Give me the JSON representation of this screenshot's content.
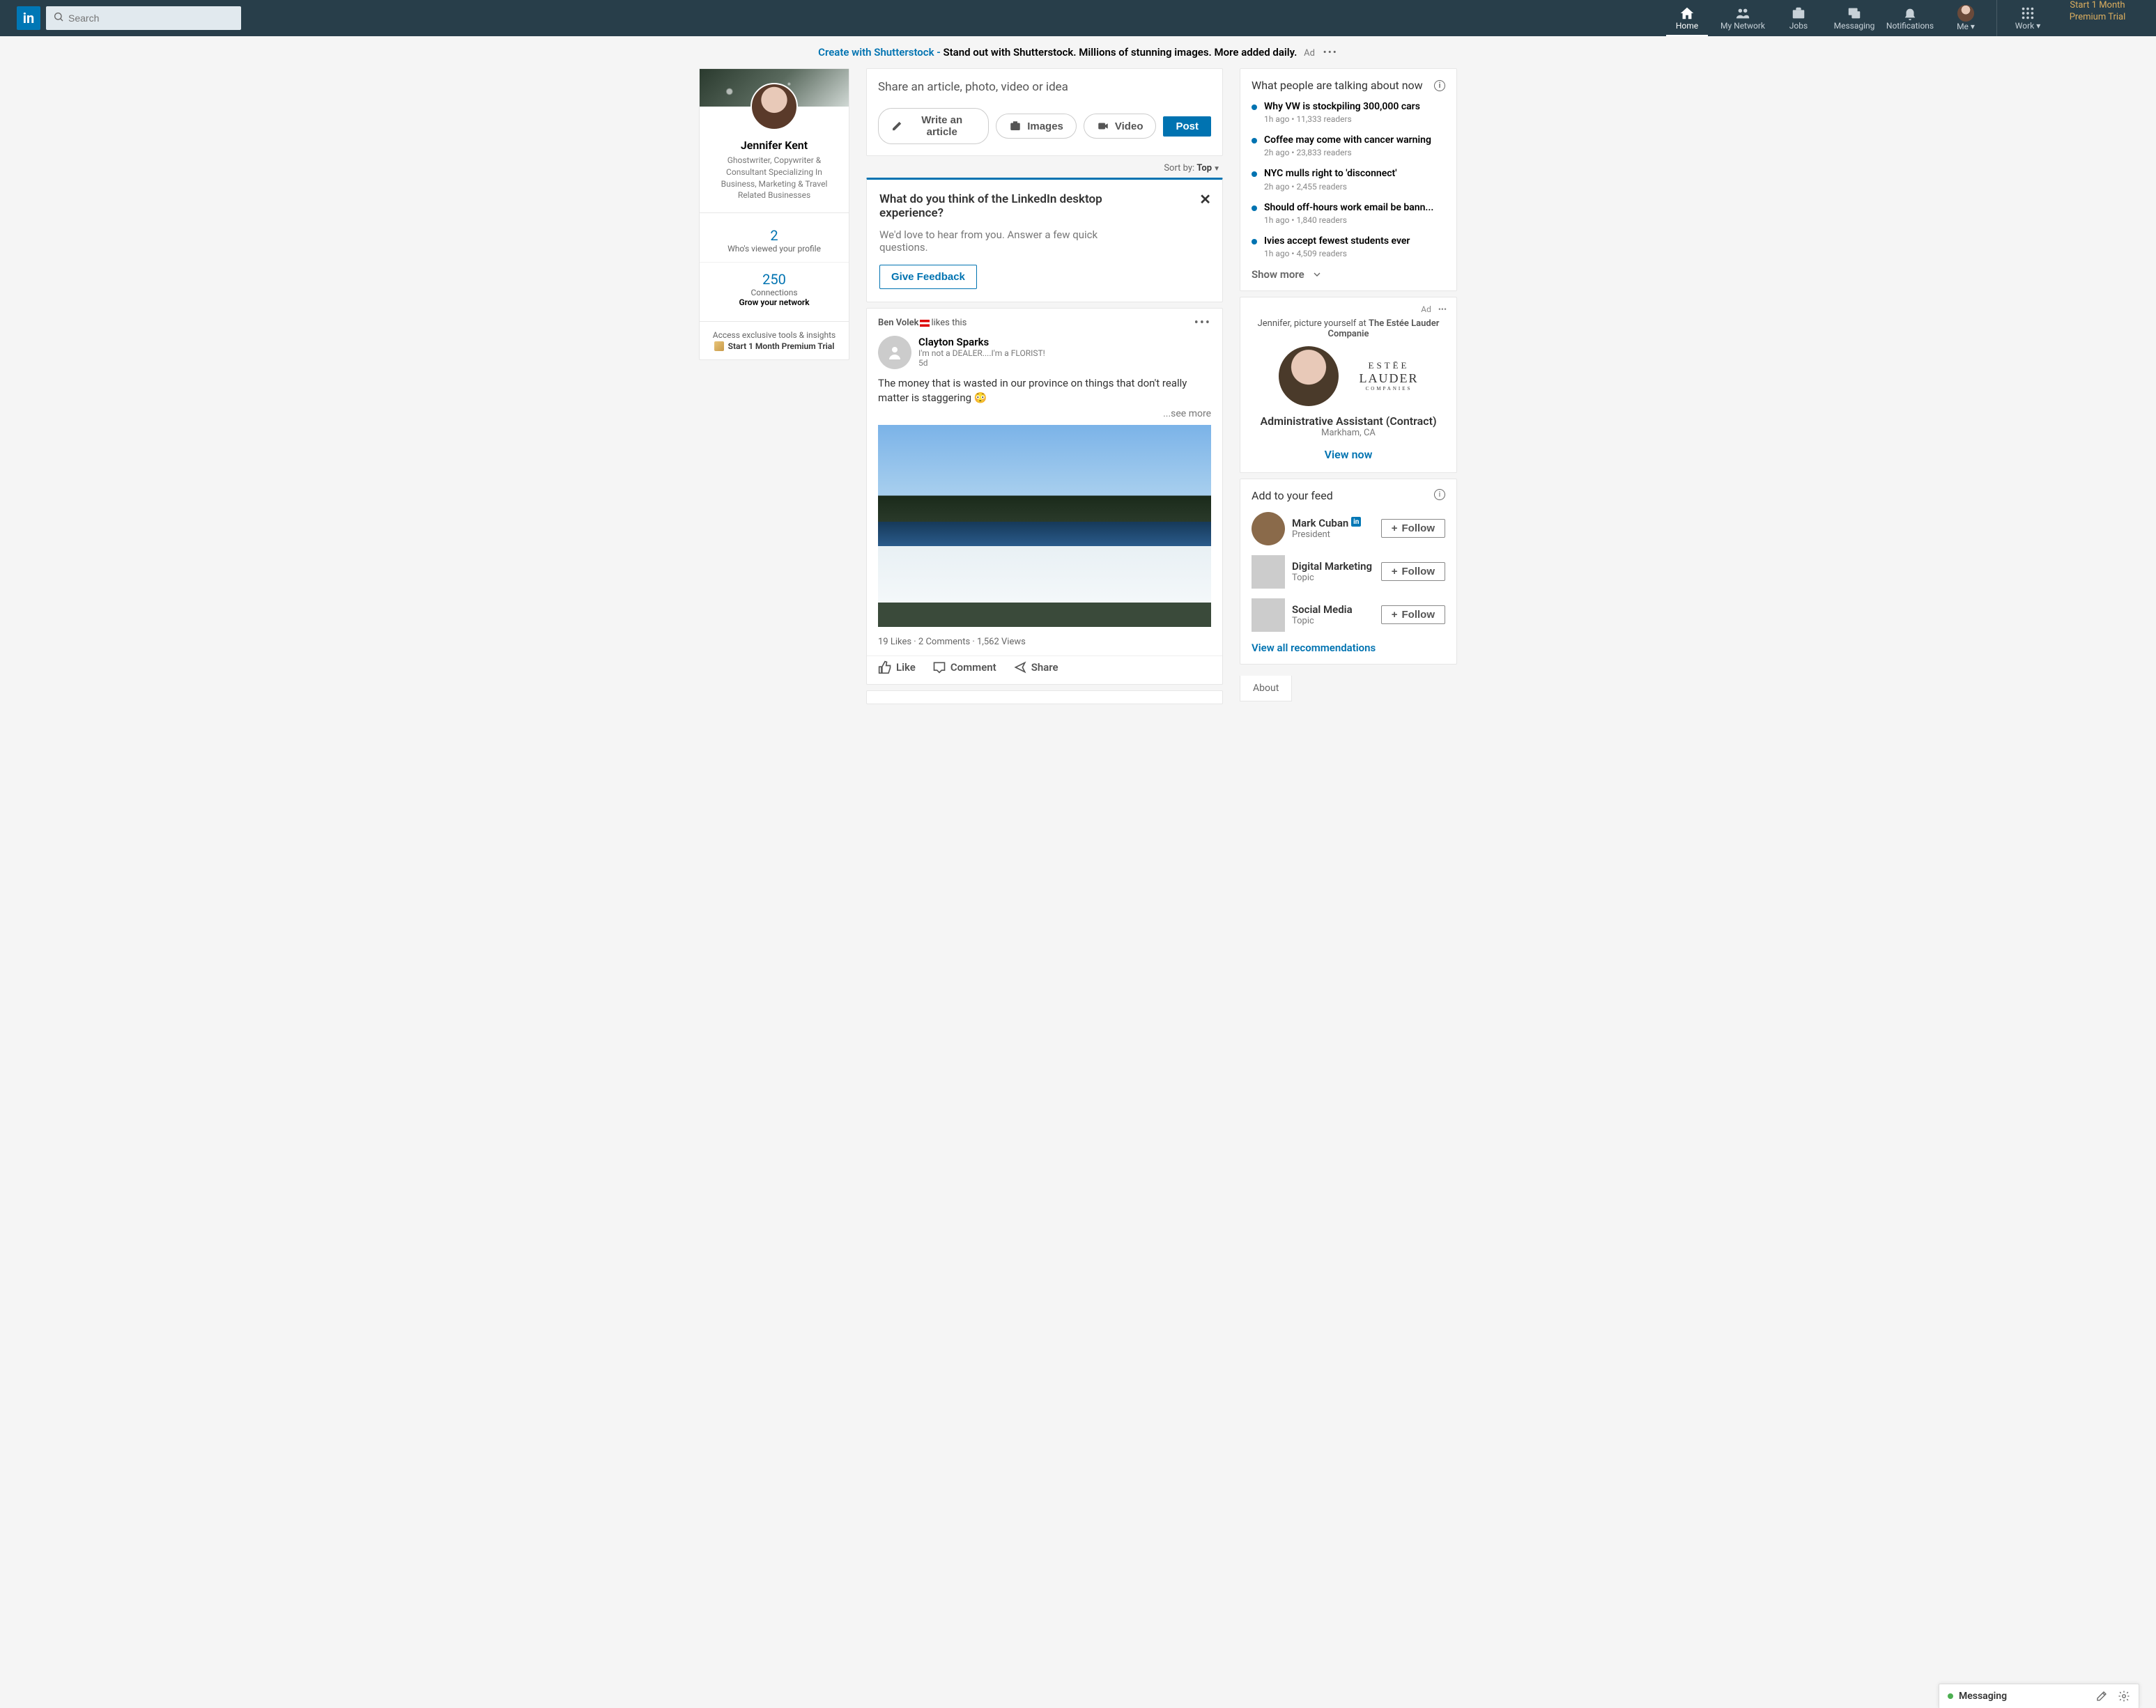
{
  "nav": {
    "logo": "in",
    "search_placeholder": "Search",
    "items": {
      "home": "Home",
      "network": "My Network",
      "jobs": "Jobs",
      "messaging": "Messaging",
      "notifications": "Notifications",
      "me": "Me",
      "work": "Work"
    },
    "premium": "Start 1 Month Premium Trial"
  },
  "ad_bar": {
    "link": "Create with Shutterstock - ",
    "bold": "Stand out with Shutterstock. Millions of stunning images. More added daily.",
    "tag": "Ad"
  },
  "profile": {
    "name": "Jennifer Kent",
    "headline": "Ghostwriter, Copywriter & Consultant Specializing In Business, Marketing & Travel Related Businesses",
    "views_count": "2",
    "views_label": "Who's viewed your profile",
    "conn_count": "250",
    "conn_label": "Connections",
    "conn_sub": "Grow your network",
    "premium_a": "Access exclusive tools & insights",
    "premium_b": "Start 1 Month Premium Trial"
  },
  "share": {
    "title": "Share an article, photo, video or idea",
    "write": "Write an article",
    "images": "Images",
    "video": "Video",
    "post": "Post"
  },
  "sort": {
    "label": "Sort by: ",
    "value": "Top"
  },
  "feedback": {
    "title": "What do you think of the LinkedIn desktop experience?",
    "text": "We'd love to hear from you. Answer a few quick questions.",
    "button": "Give Feedback"
  },
  "post": {
    "top_name": "Ben Volek",
    "top_action": " likes this",
    "author": "Clayton Sparks",
    "tagline": "I'm not a DEALER....I'm a FLORIST!",
    "age": "5d",
    "body": "The money that is wasted in our province on things that don't really matter is staggering 😳",
    "see_more": "...see more",
    "stats": "19 Likes · 2 Comments · 1,562 Views",
    "like": "Like",
    "comment": "Comment",
    "share": "Share"
  },
  "news": {
    "heading": "What people are talking about now",
    "items": [
      {
        "title": "Why VW is stockpiling 300,000 cars",
        "meta": "1h ago • 11,333 readers"
      },
      {
        "title": "Coffee may come with cancer warning",
        "meta": "2h ago • 23,833 readers"
      },
      {
        "title": "NYC mulls right to 'disconnect'",
        "meta": "2h ago • 2,455 readers"
      },
      {
        "title": "Should off-hours work email be bann...",
        "meta": "1h ago • 1,840 readers"
      },
      {
        "title": "Ivies accept fewest students ever",
        "meta": "1h ago • 4,509 readers"
      }
    ],
    "show_more": "Show more"
  },
  "job_ad": {
    "ad_tag": "Ad",
    "tagline_a": "Jennifer, picture yourself at ",
    "tagline_b": "The Estée Lauder Companie",
    "company_l1": "ESTĒE",
    "company_l2": "LAUDER",
    "company_l3": "COMPANIES",
    "role": "Administrative Assistant (Contract)",
    "location": "Markham, CA",
    "view": "View now"
  },
  "feed_add": {
    "heading": "Add to your feed",
    "items": [
      {
        "name": "Mark Cuban",
        "sub": "President",
        "badge": true
      },
      {
        "name": "Digital Marketing",
        "sub": "Topic",
        "badge": false
      },
      {
        "name": "Social Media",
        "sub": "Topic",
        "badge": false
      }
    ],
    "follow": "Follow",
    "view_all": "View all recommendations"
  },
  "about_tab": "About",
  "messaging": {
    "title": "Messaging"
  }
}
